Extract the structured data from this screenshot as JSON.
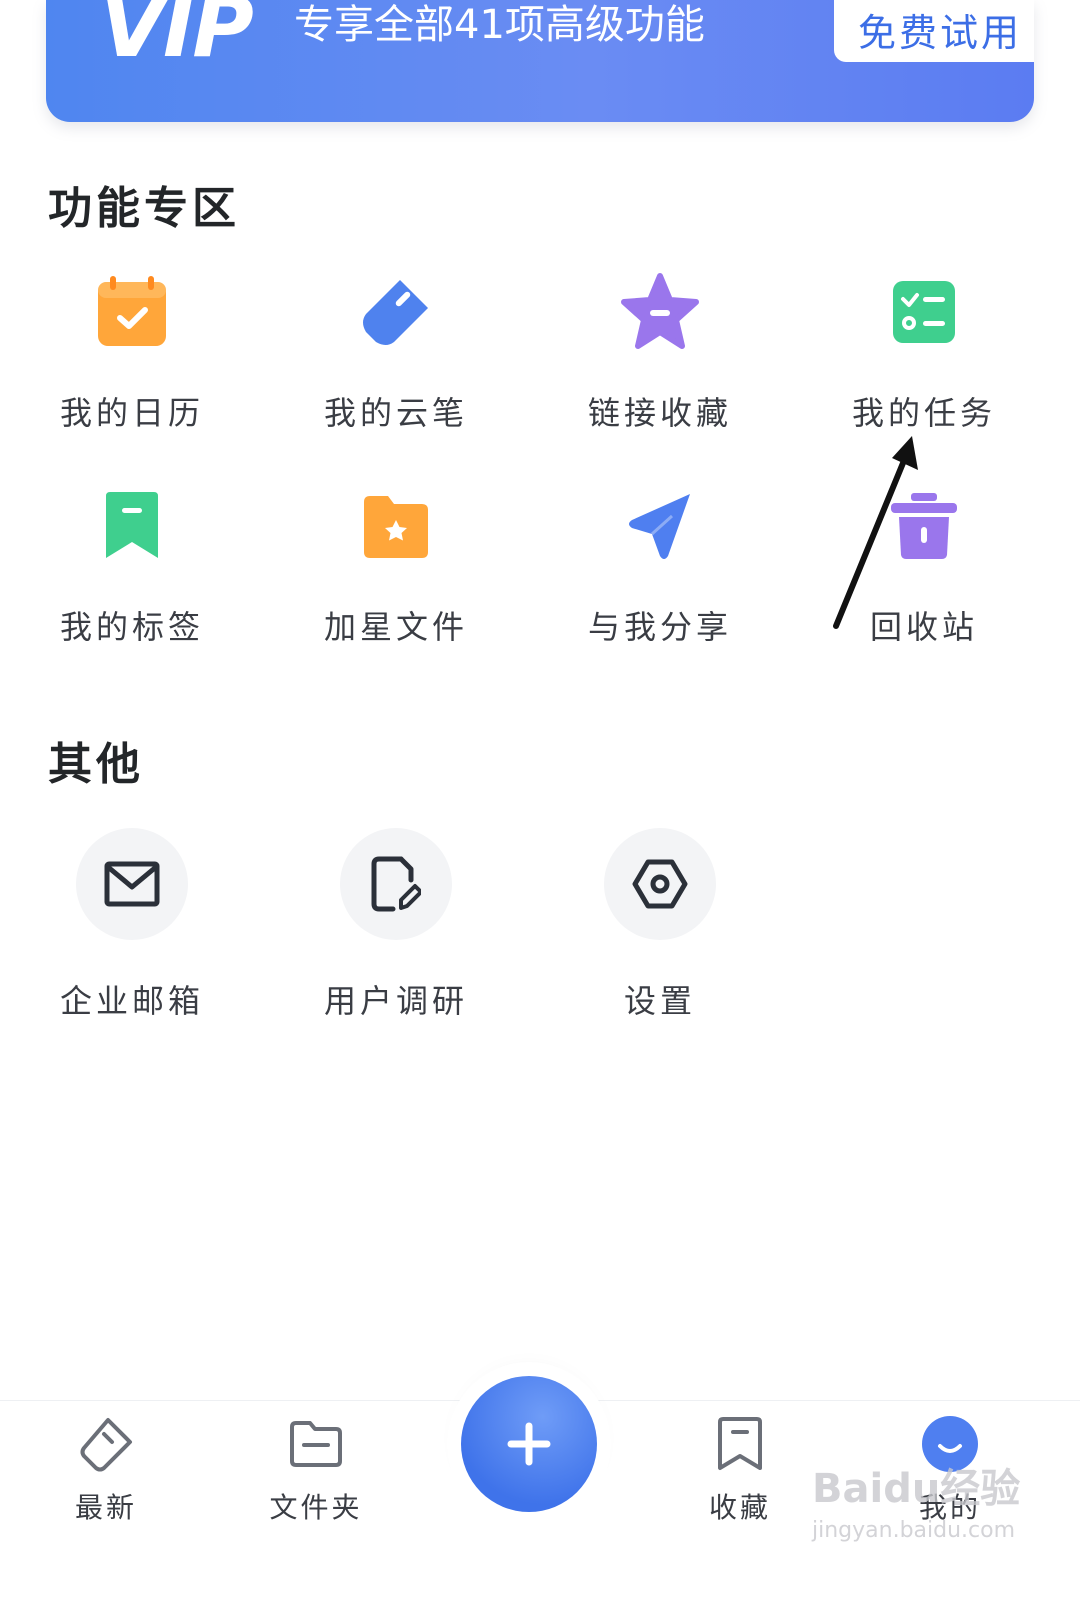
{
  "banner": {
    "logo": "VIP",
    "text": "专享全部41项高级功能",
    "trial_button": "免费试用"
  },
  "features": {
    "title": "功能专区",
    "items": [
      {
        "label": "我的日历",
        "icon": "calendar-icon"
      },
      {
        "label": "我的云笔",
        "icon": "cloud-pen-icon"
      },
      {
        "label": "链接收藏",
        "icon": "star-icon"
      },
      {
        "label": "我的任务",
        "icon": "task-list-icon"
      },
      {
        "label": "我的标签",
        "icon": "bookmark-icon"
      },
      {
        "label": "加星文件",
        "icon": "star-folder-icon"
      },
      {
        "label": "与我分享",
        "icon": "send-icon"
      },
      {
        "label": "回收站",
        "icon": "trash-icon"
      }
    ]
  },
  "others": {
    "title": "其他",
    "items": [
      {
        "label": "企业邮箱",
        "icon": "mail-icon"
      },
      {
        "label": "用户调研",
        "icon": "survey-icon"
      },
      {
        "label": "设置",
        "icon": "settings-icon"
      }
    ]
  },
  "nav": {
    "items": [
      {
        "label": "最新",
        "icon": "tag-icon"
      },
      {
        "label": "文件夹",
        "icon": "folder-icon"
      },
      {
        "label": "收藏",
        "icon": "bookmark-icon"
      },
      {
        "label": "我的",
        "icon": "profile-icon"
      }
    ],
    "fab_icon": "plus-icon"
  },
  "watermark": {
    "main": "Baidu经验",
    "sub": "jingyan.baidu.com"
  },
  "colors": {
    "accent": "#4f7ff0",
    "orange": "#ffa63a",
    "purple": "#9a76ec",
    "green": "#3fcf8e"
  }
}
